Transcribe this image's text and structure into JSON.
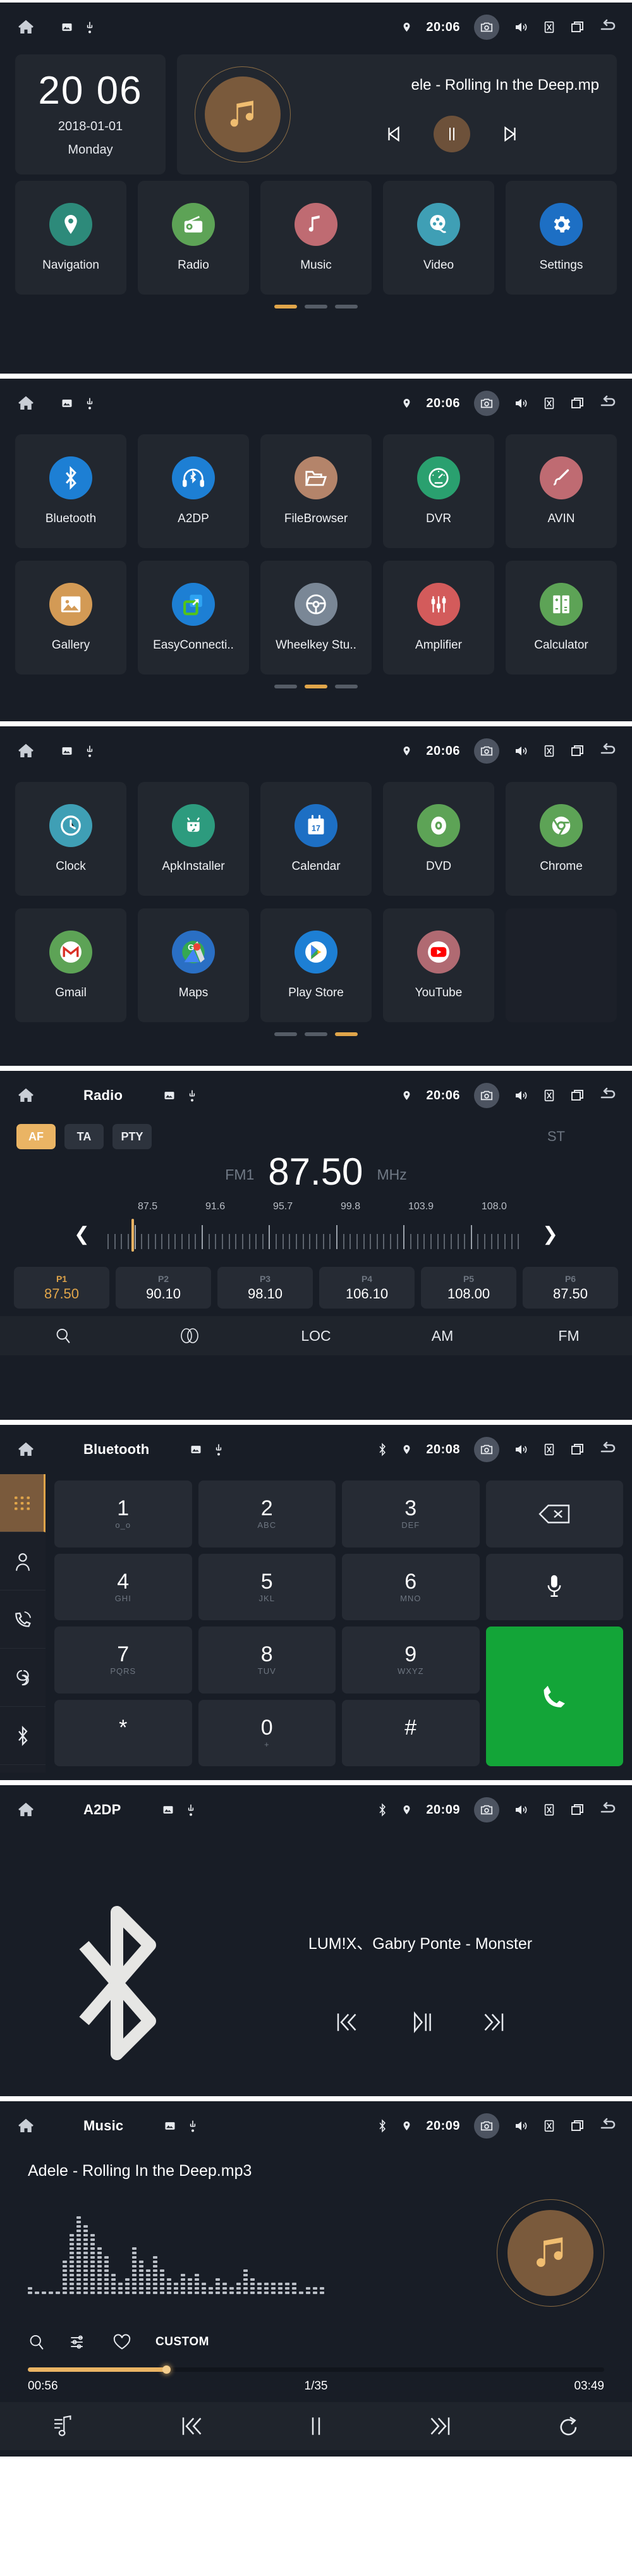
{
  "status_bar": {
    "time_2006": "20:06",
    "time_2008": "20:08",
    "time_2009": "20:09",
    "icons": [
      "home-icon",
      "sdcard-icon",
      "usb-icon",
      "location-icon",
      "camera-icon",
      "volume-icon",
      "mute-icon",
      "recents-icon",
      "back-icon",
      "bluetooth-icon"
    ]
  },
  "home": {
    "clock": {
      "time": "20 06",
      "date": "2018-01-01",
      "day": "Monday"
    },
    "now_playing": {
      "title": "ele - Rolling In the Deep.mp",
      "prev": "prev-icon",
      "pause": "pause-icon",
      "next": "next-icon"
    },
    "apps": [
      {
        "label": "Navigation",
        "icon": "location-pin-icon",
        "color": "#2d8a7a"
      },
      {
        "label": "Radio",
        "icon": "radio-icon",
        "color": "#5da356"
      },
      {
        "label": "Music",
        "icon": "music-note-icon",
        "color": "#bf6b72"
      },
      {
        "label": "Video",
        "icon": "film-reel-icon",
        "color": "#3f9fb5"
      },
      {
        "label": "Settings",
        "icon": "gear-icon",
        "color": "#1d6fc4"
      }
    ],
    "page_dots": {
      "count": 3,
      "active": 0
    }
  },
  "apps_page2": {
    "row1": [
      {
        "label": "Bluetooth",
        "icon": "bluetooth-icon",
        "color": "#1d7fd4"
      },
      {
        "label": "A2DP",
        "icon": "bluetooth-headset-icon",
        "color": "#1d7fd4"
      },
      {
        "label": "FileBrowser",
        "icon": "folder-icon",
        "color": "#b4846a"
      },
      {
        "label": "DVR",
        "icon": "gauge-icon",
        "color": "#2aa06f"
      },
      {
        "label": "AVIN",
        "icon": "avin-plug-icon",
        "color": "#bf6b72"
      }
    ],
    "row2": [
      {
        "label": "Gallery",
        "icon": "photo-icon",
        "color": "#d39a55"
      },
      {
        "label": "EasyConnecti..",
        "icon": "easyconnection-icon",
        "color": "#1d7fd4"
      },
      {
        "label": "Wheelkey Stu..",
        "icon": "steering-wheel-icon",
        "color": "#7a8796"
      },
      {
        "label": "Amplifier",
        "icon": "sliders-icon",
        "color": "#d35b5b"
      },
      {
        "label": "Calculator",
        "icon": "calculator-icon",
        "color": "#5da356"
      }
    ],
    "page_dots": {
      "count": 3,
      "active": 1
    }
  },
  "apps_page3": {
    "row1": [
      {
        "label": "Clock",
        "icon": "clock-icon",
        "color": "#3f9fb5"
      },
      {
        "label": "ApkInstaller",
        "icon": "android-wrench-icon",
        "color": "#2d9b7e"
      },
      {
        "label": "Calendar",
        "icon": "calendar-icon",
        "color": "#1d6fc4"
      },
      {
        "label": "DVD",
        "icon": "disc-icon",
        "color": "#5da356"
      },
      {
        "label": "Chrome",
        "icon": "chrome-icon",
        "color": "#5da356"
      }
    ],
    "row2": [
      {
        "label": "Gmail",
        "icon": "gmail-icon",
        "color": "#5da356"
      },
      {
        "label": "Maps",
        "icon": "maps-icon",
        "color": "#2a6fc4"
      },
      {
        "label": "Play Store",
        "icon": "play-store-icon",
        "color": "#1d7fd4"
      },
      {
        "label": "YouTube",
        "icon": "youtube-icon",
        "color": "#b06a72"
      },
      {
        "label": "",
        "icon": "",
        "color": ""
      }
    ],
    "page_dots": {
      "count": 3,
      "active": 2
    }
  },
  "radio": {
    "title": "Radio",
    "chips": [
      {
        "label": "AF",
        "active": true
      },
      {
        "label": "TA",
        "active": false
      },
      {
        "label": "PTY",
        "active": false
      }
    ],
    "stereo_label": "ST",
    "band": "FM1",
    "frequency": "87.50",
    "unit": "MHz",
    "scale_labels": [
      "87.5",
      "91.6",
      "95.7",
      "99.8",
      "103.9",
      "108.0"
    ],
    "scale_min": 87.5,
    "scale_max": 108.0,
    "current": 87.5,
    "prev_icon": "chevron-left-icon",
    "next_icon": "chevron-right-icon",
    "presets": [
      {
        "index": "P1",
        "value": "87.50",
        "active": true
      },
      {
        "index": "P2",
        "value": "90.10",
        "active": false
      },
      {
        "index": "P3",
        "value": "98.10",
        "active": false
      },
      {
        "index": "P4",
        "value": "106.10",
        "active": false
      },
      {
        "index": "P5",
        "value": "108.00",
        "active": false
      },
      {
        "index": "P6",
        "value": "87.50",
        "active": false
      }
    ],
    "dock": [
      {
        "label": "",
        "icon": "search-icon"
      },
      {
        "label": "",
        "icon": "stereo-icon"
      },
      {
        "label": "LOC",
        "icon": ""
      },
      {
        "label": "AM",
        "icon": ""
      },
      {
        "label": "FM",
        "icon": ""
      }
    ]
  },
  "bluetooth": {
    "title": "Bluetooth",
    "rail": [
      {
        "name": "dialpad-icon",
        "active": true
      },
      {
        "name": "contacts-icon",
        "active": false
      },
      {
        "name": "call-log-icon",
        "active": false
      },
      {
        "name": "sync-icon",
        "active": false
      },
      {
        "name": "bluetooth-settings-icon",
        "active": false
      }
    ],
    "keys": [
      {
        "num": "1",
        "sub": "o_o",
        "type": "digit"
      },
      {
        "num": "2",
        "sub": "ABC",
        "type": "digit"
      },
      {
        "num": "3",
        "sub": "DEF",
        "type": "digit"
      },
      {
        "num": "",
        "sub": "",
        "type": "backspace"
      },
      {
        "num": "4",
        "sub": "GHI",
        "type": "digit"
      },
      {
        "num": "5",
        "sub": "JKL",
        "type": "digit"
      },
      {
        "num": "6",
        "sub": "MNO",
        "type": "digit"
      },
      {
        "num": "",
        "sub": "",
        "type": "mic"
      },
      {
        "num": "7",
        "sub": "PQRS",
        "type": "digit"
      },
      {
        "num": "8",
        "sub": "TUV",
        "type": "digit"
      },
      {
        "num": "9",
        "sub": "WXYZ",
        "type": "digit"
      },
      {
        "num": "",
        "sub": "",
        "type": "call"
      },
      {
        "num": "*",
        "sub": "",
        "type": "digit"
      },
      {
        "num": "0",
        "sub": "+",
        "type": "digit"
      },
      {
        "num": "#",
        "sub": "",
        "type": "digit"
      },
      {
        "num": "",
        "sub": "",
        "type": "blank"
      }
    ]
  },
  "a2dp": {
    "title": "A2DP",
    "track": "LUM!X、Gabry Ponte - Monster",
    "controls": [
      "prev-track-icon",
      "play-pause-icon",
      "next-track-icon"
    ]
  },
  "music": {
    "title": "Music",
    "track": "Adele - Rolling In the Deep.mp3",
    "tools": [
      {
        "label": "",
        "icon": "search-icon"
      },
      {
        "label": "",
        "icon": "equalizer-icon"
      },
      {
        "label": "",
        "icon": "heart-icon"
      },
      {
        "label": "CUSTOM",
        "icon": ""
      }
    ],
    "elapsed": "00:56",
    "track_position": "1/35",
    "duration": "03:49",
    "progress_percent": 24,
    "dock": [
      "playlist-icon",
      "prev-track-icon",
      "pause-icon",
      "next-track-icon",
      "repeat-icon"
    ],
    "spectrum": [
      2,
      1,
      1,
      1,
      1,
      8,
      14,
      18,
      16,
      14,
      11,
      9,
      5,
      3,
      4,
      11,
      8,
      6,
      9,
      6,
      4,
      3,
      5,
      4,
      5,
      3,
      2,
      4,
      3,
      2,
      3,
      6,
      4,
      3,
      3,
      3,
      3,
      3,
      3,
      1,
      2,
      2,
      2
    ]
  },
  "colors": {
    "accent": "#e0a54a",
    "panel": "#22272f",
    "background": "#181d26",
    "call_green": "#13a538"
  }
}
